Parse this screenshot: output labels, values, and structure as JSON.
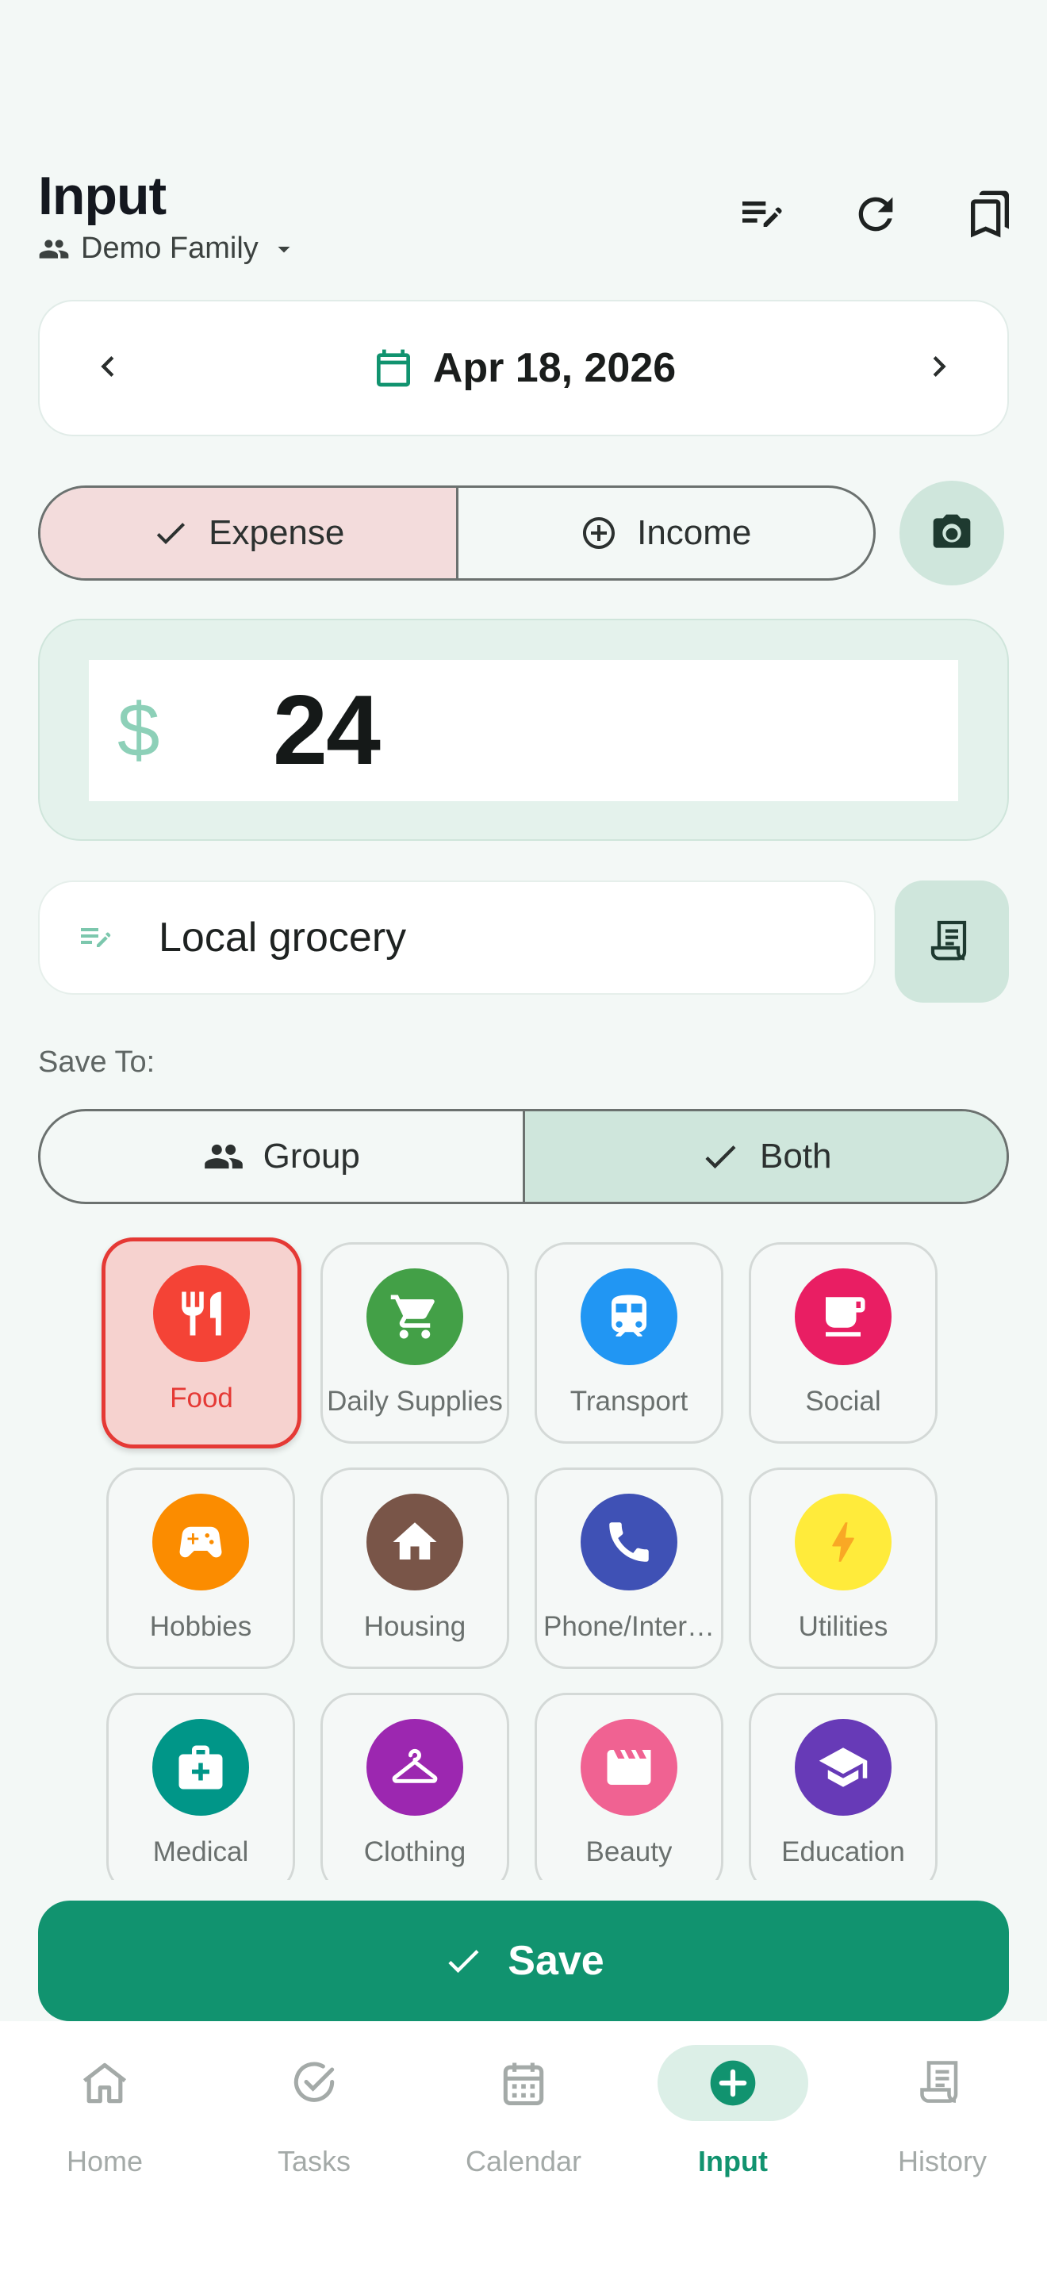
{
  "header": {
    "title": "Input",
    "family": "Demo Family",
    "icons": [
      "edit-list-icon",
      "refresh-icon",
      "bookmarks-icon"
    ]
  },
  "date": {
    "label": "Apr 18, 2026"
  },
  "type_toggle": {
    "expense": "Expense",
    "income": "Income",
    "selected": "Expense"
  },
  "amount": {
    "currency": "$",
    "value": "24"
  },
  "note": {
    "value": "Local grocery"
  },
  "save_to": {
    "label": "Save To:",
    "group": "Group",
    "both": "Both",
    "selected": "Both"
  },
  "categories": [
    {
      "label": "Food",
      "color": "#f44336",
      "icon": "restaurant-icon",
      "selected": true
    },
    {
      "label": "Daily Supplies",
      "color": "#43a047",
      "icon": "cart-icon"
    },
    {
      "label": "Transport",
      "color": "#2196f3",
      "icon": "train-icon"
    },
    {
      "label": "Social",
      "color": "#e91e63",
      "icon": "cup-icon"
    },
    {
      "label": "Hobbies",
      "color": "#fb8c00",
      "icon": "gamepad-icon"
    },
    {
      "label": "Housing",
      "color": "#795548",
      "icon": "home-icon"
    },
    {
      "label": "Phone/Inter…",
      "color": "#3f51b5",
      "icon": "phone-icon"
    },
    {
      "label": "Utilities",
      "color": "#ffeb3b",
      "icon": "bolt-icon"
    },
    {
      "label": "Medical",
      "color": "#009688",
      "icon": "medkit-icon"
    },
    {
      "label": "Clothing",
      "color": "#9c27b0",
      "icon": "hanger-icon"
    },
    {
      "label": "Beauty",
      "color": "#f06292",
      "icon": "clapper-icon"
    },
    {
      "label": "Education",
      "color": "#673ab7",
      "icon": "school-icon"
    }
  ],
  "save_button": "Save",
  "nav": [
    {
      "label": "Home",
      "icon": "home-outline-icon"
    },
    {
      "label": "Tasks",
      "icon": "check-circle-icon"
    },
    {
      "label": "Calendar",
      "icon": "calendar-icon"
    },
    {
      "label": "Input",
      "icon": "add-circle-icon",
      "active": true
    },
    {
      "label": "History",
      "icon": "receipt-icon"
    }
  ],
  "colors": {
    "accent": "#11936f",
    "expense_selected_bg": "#f3dcdc",
    "tonal": "#cfe6dc"
  }
}
